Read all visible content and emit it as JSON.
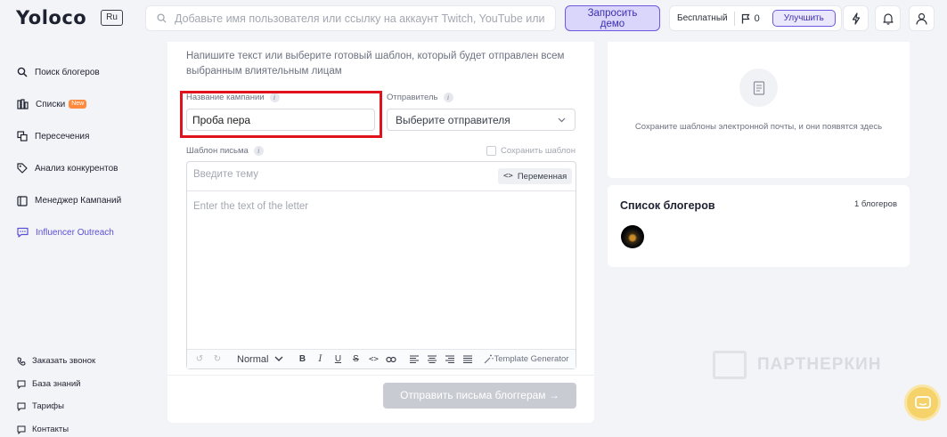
{
  "header": {
    "logo": "Yoloco",
    "language": "Ru",
    "search_placeholder": "Добавьте имя пользователя или ссылку на аккаунт Twitch, YouTube или Instagram",
    "demo_button_line1": "Запросить",
    "demo_button_line2": "демо",
    "plan": "Бесплатный",
    "flag_count": "0",
    "upgrade": "Улучшить",
    "icons": [
      "lightning-icon",
      "bell-icon",
      "user-icon"
    ]
  },
  "sidebar": {
    "items": [
      {
        "label": "Поиск блогеров",
        "icon": "search-icon",
        "active": false
      },
      {
        "label": "Списки",
        "icon": "list-icon",
        "badge": "New",
        "active": false
      },
      {
        "label": "Пересечения",
        "icon": "intersections-icon",
        "active": false
      },
      {
        "label": "Анализ конкурентов",
        "icon": "tag-icon",
        "active": false
      },
      {
        "label": "Менеджер Кампаний",
        "icon": "calendar-icon",
        "active": false
      },
      {
        "label": "Influencer Outreach",
        "icon": "chat-icon",
        "active": true
      }
    ],
    "bottom": [
      {
        "label": "Заказать звонок",
        "icon": "phone-icon"
      },
      {
        "label": "База знаний",
        "icon": "book-icon"
      },
      {
        "label": "Тарифы",
        "icon": "tariff-icon"
      },
      {
        "label": "Контакты",
        "icon": "contacts-icon"
      }
    ]
  },
  "form": {
    "intro": "Напишите текст или выберите готовый шаблон, который будет отправлен всем выбранным влиятельным лицам",
    "campaign_label": "Название кампании",
    "campaign_value": "Проба пера",
    "sender_label": "Отправитель",
    "sender_placeholder": "Выберите отправителя",
    "template_label": "Шаблон письма",
    "save_template": "Сохранить шаблон",
    "subject_placeholder": "Введите тему",
    "variable_button": "Переменная",
    "body_placeholder": "Enter the text of the letter",
    "toolbar_format": "Normal",
    "template_generator": "Template Generator",
    "send_button": "Отправить письма блоггерам →"
  },
  "templates": {
    "empty_message": "Сохраните шаблоны электронной почты, и они появятся здесь"
  },
  "bloggers": {
    "title": "Список блогеров",
    "count": "1 блогеров"
  },
  "watermark": "ПАРТНЕРКИН",
  "colors": {
    "accent": "#6a5ae0",
    "highlight": "#e0121c",
    "disabled": "#c8cbd2"
  }
}
